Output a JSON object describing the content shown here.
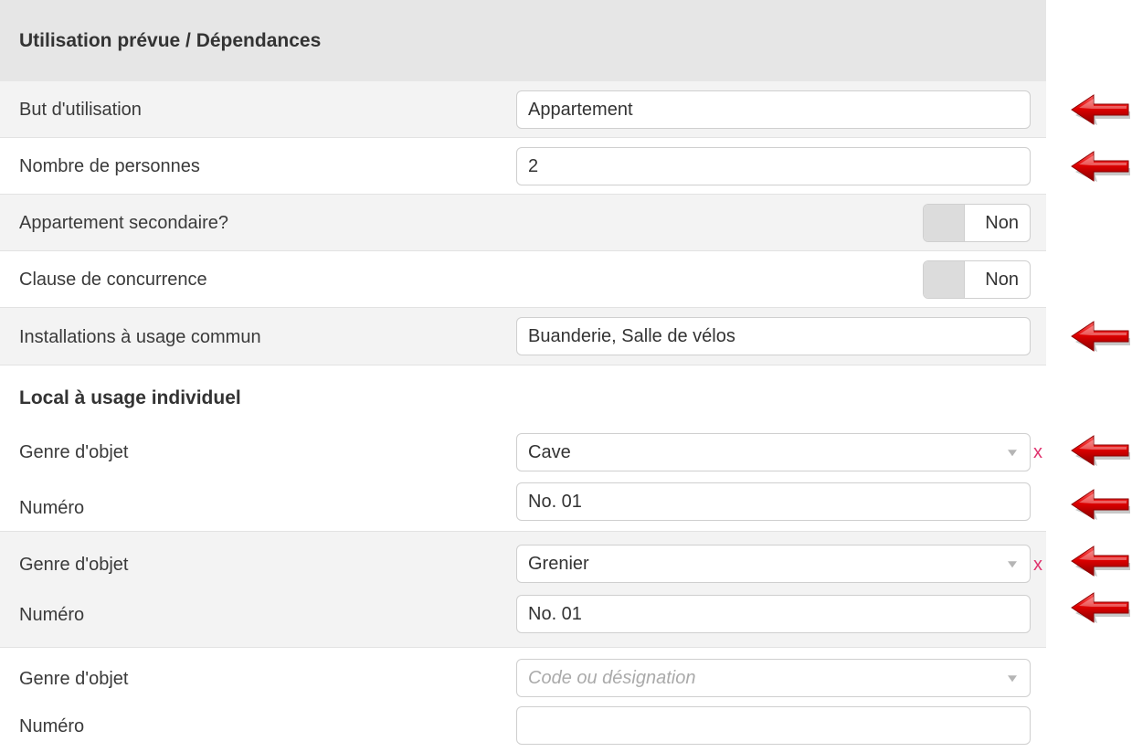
{
  "panel": {
    "title": "Utilisation prévue / Dépendances",
    "usage": {
      "label": "But d'utilisation",
      "value": "Appartement"
    },
    "persons": {
      "label": "Nombre de personnes",
      "value": "2"
    },
    "secondary": {
      "label": "Appartement secondaire?",
      "value": "Non"
    },
    "competition": {
      "label": "Clause de concurrence",
      "value": "Non"
    },
    "common": {
      "label": "Installations à usage commun",
      "value": "Buanderie, Salle de vélos"
    }
  },
  "individual": {
    "title": "Local à usage individuel",
    "items": [
      {
        "type_label": "Genre d'objet",
        "type_value": "Cave",
        "clear": "x",
        "number_label": "Numéro",
        "number_value": "No. 01"
      },
      {
        "type_label": "Genre d'objet",
        "type_value": "Grenier",
        "clear": "x",
        "number_label": "Numéro",
        "number_value": "No. 01"
      },
      {
        "type_label": "Genre d'objet",
        "type_placeholder": "Code ou désignation",
        "number_label": "Numéro",
        "number_value": ""
      }
    ]
  },
  "colors": {
    "arrow": "#d40000",
    "clear": "#e0336e",
    "header_bg": "#e6e6e6",
    "shaded_bg": "#f3f3f3"
  },
  "icons": {
    "arrow": "red-left-arrow-icon",
    "caret": "chevron-down-icon"
  }
}
